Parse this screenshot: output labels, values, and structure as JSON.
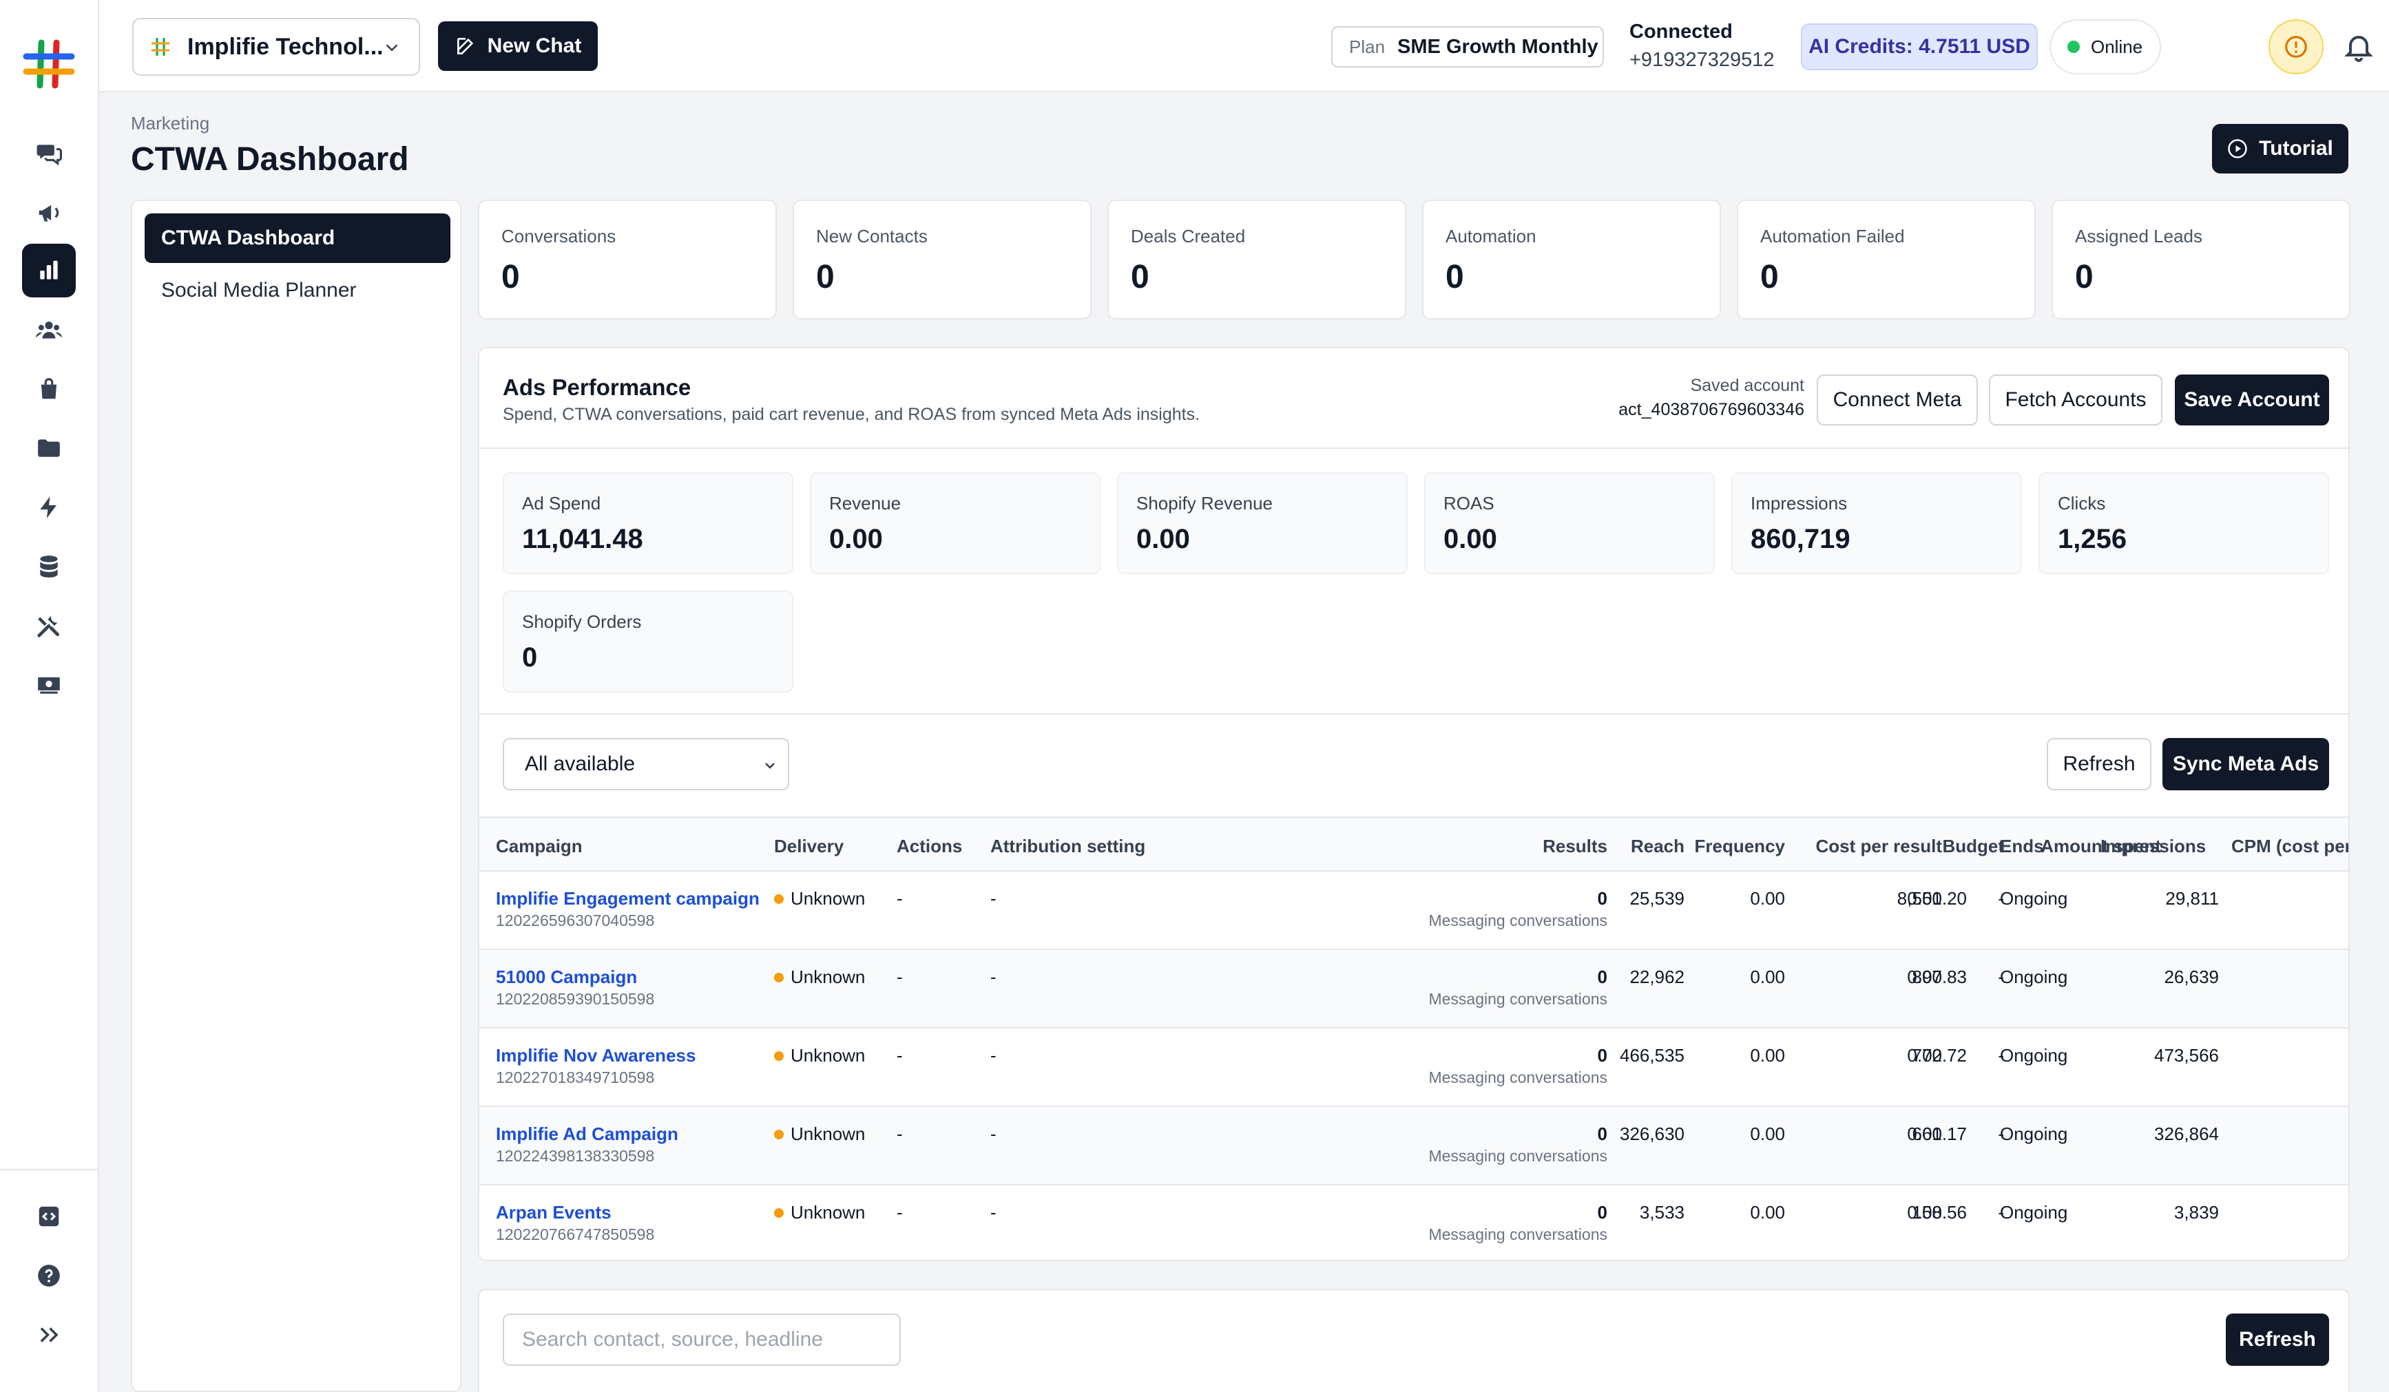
{
  "colors": {
    "accent": "#111827",
    "link": "#1d4ed8",
    "online": "#22c55e",
    "status_unknown": "#f59e0b",
    "credits_bg": "#e0e7ff"
  },
  "rail": {
    "icons": [
      "chat-bubbles-icon",
      "megaphone-icon",
      "bar-chart-icon",
      "users-icon",
      "shopping-bag-icon",
      "folder-icon",
      "lightning-icon",
      "database-icon",
      "tools-icon",
      "money-icon",
      "code-icon",
      "help-icon",
      "expand-icon"
    ],
    "active": "bar-chart-icon"
  },
  "topbar": {
    "org_name": "Implifie Technol...",
    "new_chat": "New Chat",
    "plan_label": "Plan",
    "plan_value": "SME Growth Monthly",
    "connected_label": "Connected",
    "phone": "+919327329512",
    "credits": "AI Credits: 4.7511 USD",
    "status": "Online"
  },
  "page": {
    "breadcrumb": "Marketing",
    "title": "CTWA Dashboard",
    "tutorial": "Tutorial"
  },
  "subnav": {
    "items": [
      "CTWA Dashboard",
      "Social Media Planner"
    ]
  },
  "kpis": [
    {
      "label": "Conversations",
      "value": "0"
    },
    {
      "label": "New Contacts",
      "value": "0"
    },
    {
      "label": "Deals Created",
      "value": "0"
    },
    {
      "label": "Automation",
      "value": "0"
    },
    {
      "label": "Automation Failed",
      "value": "0"
    },
    {
      "label": "Assigned Leads",
      "value": "0"
    }
  ],
  "ads": {
    "title": "Ads Performance",
    "subtitle": "Spend, CTWA conversations, paid cart revenue, and ROAS from synced Meta Ads insights.",
    "saved_label": "Saved account",
    "saved_value": "act_4038706769603346",
    "connect": "Connect Meta",
    "fetch": "Fetch Accounts",
    "save": "Save Account",
    "metrics": [
      {
        "label": "Ad Spend",
        "value": "11,041.48"
      },
      {
        "label": "Revenue",
        "value": "0.00"
      },
      {
        "label": "Shopify Revenue",
        "value": "0.00"
      },
      {
        "label": "ROAS",
        "value": "0.00"
      },
      {
        "label": "Impressions",
        "value": "860,719"
      },
      {
        "label": "Clicks",
        "value": "1,256"
      },
      {
        "label": "Shopify Orders",
        "value": "0"
      }
    ],
    "filter_value": "All available",
    "refresh": "Refresh",
    "sync": "Sync Meta Ads",
    "columns": [
      "Campaign",
      "Delivery",
      "Actions",
      "Attribution setting",
      "Results",
      "Reach",
      "Frequency",
      "Cost per result",
      "Budget",
      "Amount spent",
      "Ends",
      "Impressions",
      "CPM (cost per"
    ],
    "rows": [
      {
        "name": "Implifie Engagement campaign",
        "id": "120226596307040598",
        "delivery": "Unknown",
        "actions": "-",
        "attribution": "-",
        "results": "0",
        "results_sub": "Messaging conversations",
        "reach": "25,539",
        "frequency": "0.00",
        "cpr": "0.00",
        "budget": "-",
        "spent": "8,551.20",
        "ends": "Ongoing",
        "impressions": "29,811"
      },
      {
        "name": "51000 Campaign",
        "id": "120220859390150598",
        "delivery": "Unknown",
        "actions": "-",
        "attribution": "-",
        "results": "0",
        "results_sub": "Messaging conversations",
        "reach": "22,962",
        "frequency": "0.00",
        "cpr": "0.00",
        "budget": "-",
        "spent": "897.83",
        "ends": "Ongoing",
        "impressions": "26,639"
      },
      {
        "name": "Implifie Nov Awareness",
        "id": "120227018349710598",
        "delivery": "Unknown",
        "actions": "-",
        "attribution": "-",
        "results": "0",
        "results_sub": "Messaging conversations",
        "reach": "466,535",
        "frequency": "0.00",
        "cpr": "0.00",
        "budget": "-",
        "spent": "772.72",
        "ends": "Ongoing",
        "impressions": "473,566"
      },
      {
        "name": "Implifie Ad Campaign",
        "id": "120224398138330598",
        "delivery": "Unknown",
        "actions": "-",
        "attribution": "-",
        "results": "0",
        "results_sub": "Messaging conversations",
        "reach": "326,630",
        "frequency": "0.00",
        "cpr": "0.00",
        "budget": "-",
        "spent": "661.17",
        "ends": "Ongoing",
        "impressions": "326,864"
      },
      {
        "name": "Arpan Events",
        "id": "120220766747850598",
        "delivery": "Unknown",
        "actions": "-",
        "attribution": "-",
        "results": "0",
        "results_sub": "Messaging conversations",
        "reach": "3,533",
        "frequency": "0.00",
        "cpr": "0.00",
        "budget": "-",
        "spent": "158.56",
        "ends": "Ongoing",
        "impressions": "3,839"
      }
    ]
  },
  "leads": {
    "search_placeholder": "Search contact, source, headline",
    "refresh": "Refresh"
  }
}
